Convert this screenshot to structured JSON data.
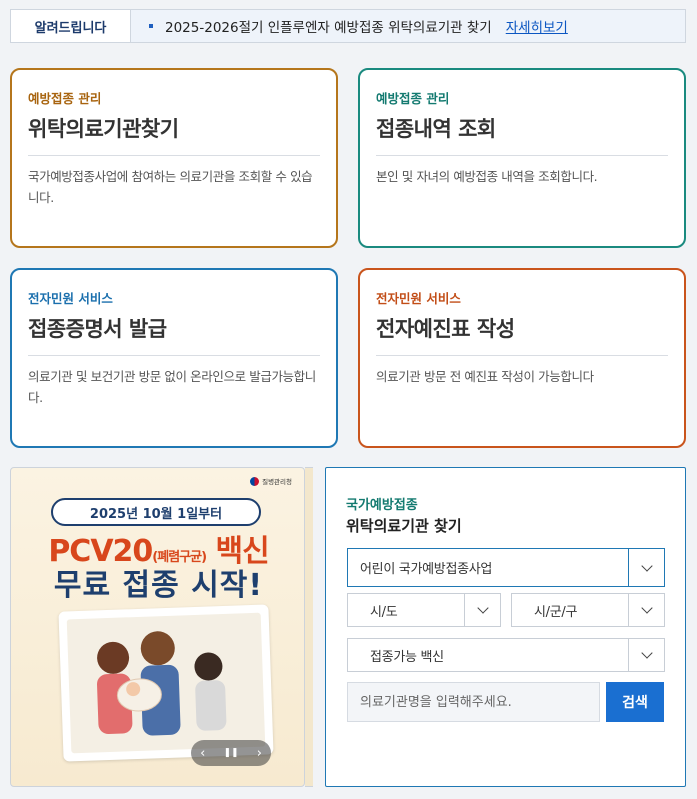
{
  "notice": {
    "label": "알려드립니다",
    "text": "2025-2026절기 인플루엔자 예방접종 위탁의료기관 찾기",
    "more": "자세히보기"
  },
  "cards": [
    {
      "category": "예방접종 관리",
      "title": "위탁의료기관찾기",
      "description": "국가예방접종사업에 참여하는 의료기관을 조회할 수 있습니다."
    },
    {
      "category": "예방접종 관리",
      "title": "접종내역 조회",
      "description": "본인 및 자녀의 예방접종 내역을 조회합니다."
    },
    {
      "category": "전자민원 서비스",
      "title": "접종증명서 발급",
      "description": "의료기관 및 보건기관 방문 없이 온라인으로 발급가능합니다."
    },
    {
      "category": "전자민원 서비스",
      "title": "전자예진표 작성",
      "description": "의료기관 방문 전 예진표 작성이 가능합니다"
    }
  ],
  "banner": {
    "agency": "질병관리청",
    "date_pill": "2025년 10월 1일부터",
    "title_a": "PCV20",
    "title_a_small": "(폐렴구균)",
    "title_b": " 백신",
    "title_line2": "무료 접종 시작!",
    "prev": "‹",
    "pause": "❚❚",
    "next": "›"
  },
  "search": {
    "subtitle": "국가예방접종",
    "title": "위탁의료기관 찾기",
    "program": "어린이 국가예방접종사업",
    "sido": "시/도",
    "sigungu": "시/군/구",
    "vaccine": "접종가능 백신",
    "input_placeholder": "의료기관명을 입력해주세요.",
    "button": "검색"
  }
}
